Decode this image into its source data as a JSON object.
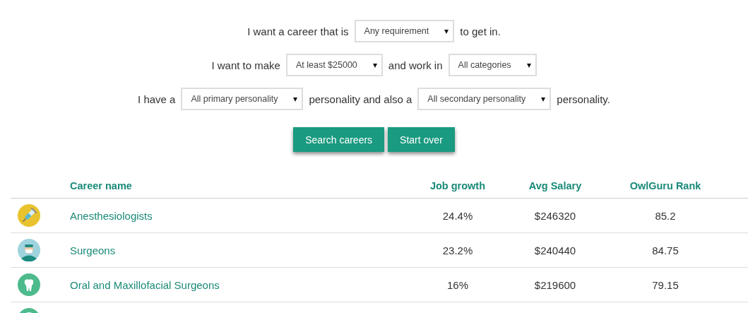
{
  "filters": [
    {
      "parts": [
        {
          "kind": "text",
          "text": "I want a career that is"
        },
        {
          "kind": "select",
          "value": "Any requirement"
        },
        {
          "kind": "text",
          "text": "to get in."
        }
      ]
    },
    {
      "parts": [
        {
          "kind": "text",
          "text": "I want to make"
        },
        {
          "kind": "select",
          "value": "At least $25000"
        },
        {
          "kind": "text",
          "text": "and work in"
        },
        {
          "kind": "select",
          "value": "All categories"
        }
      ]
    },
    {
      "parts": [
        {
          "kind": "text",
          "text": "I have a"
        },
        {
          "kind": "select",
          "value": "All primary personality"
        },
        {
          "kind": "text",
          "text": "personality and also a"
        },
        {
          "kind": "select",
          "value": "All secondary personality"
        },
        {
          "kind": "text",
          "text": "personality."
        }
      ]
    }
  ],
  "select_arrow": "▾",
  "buttons": [
    "Search careers",
    "Start over"
  ],
  "table": {
    "columns": [
      "Career name",
      "Job growth",
      "Avg Salary",
      "OwlGuru Rank"
    ],
    "rows": [
      {
        "kind": "syringe",
        "cells": [
          "Anesthesiologists",
          "24.4%",
          "$246320",
          "85.2"
        ]
      },
      {
        "kind": "surgeon",
        "cells": [
          "Surgeons",
          "23.2%",
          "$240440",
          "84.75"
        ]
      },
      {
        "kind": "tooth",
        "cells": [
          "Oral and Maxillofacial Surgeons",
          "16%",
          "$219600",
          "79.15"
        ]
      },
      {
        "kind": "partial",
        "cells": []
      }
    ]
  }
}
